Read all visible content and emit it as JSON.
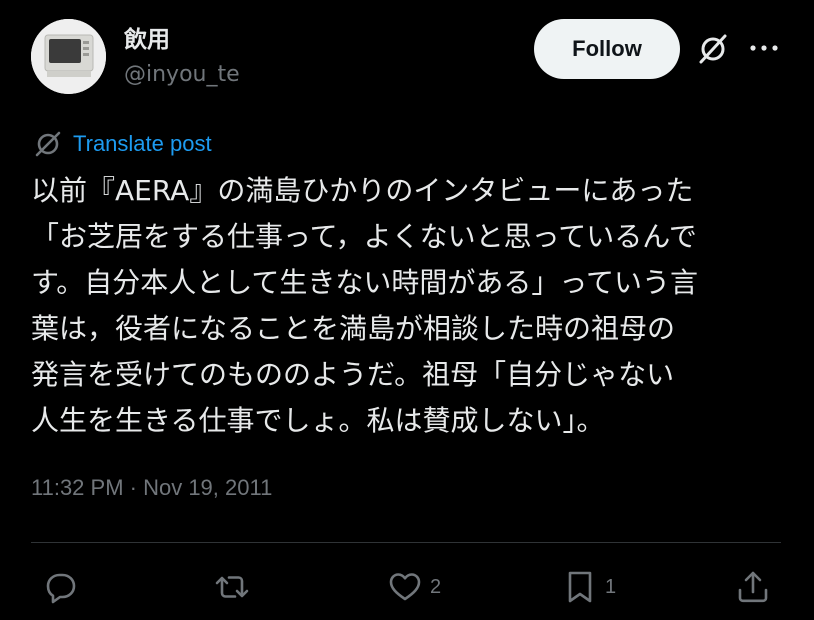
{
  "author": {
    "display_name": "飲用",
    "handle": "@inyou_te"
  },
  "header": {
    "follow_label": "Follow"
  },
  "translate": {
    "label": "Translate post"
  },
  "post": {
    "text": "以前『AERA』の満島ひかりのインタビューにあった\n「お芝居をする仕事って，よくないと思っているんで\nす。自分本人として生きない時間がある」っていう言\n葉は，役者になることを満島が相談した時の祖母の\n発言を受けてのもののようだ。祖母「自分じゃない\n人生を生きる仕事でしょ。私は賛成しない」。",
    "timestamp": "11:32 PM · Nov 19, 2011"
  },
  "actions": {
    "reply_count": "",
    "repost_count": "",
    "like_count": "2",
    "bookmark_count": "1"
  },
  "colors": {
    "background": "#000000",
    "text": "#e7e9ea",
    "muted": "#71767b",
    "link": "#1d9bf0",
    "button_bg": "#eff3f4"
  }
}
